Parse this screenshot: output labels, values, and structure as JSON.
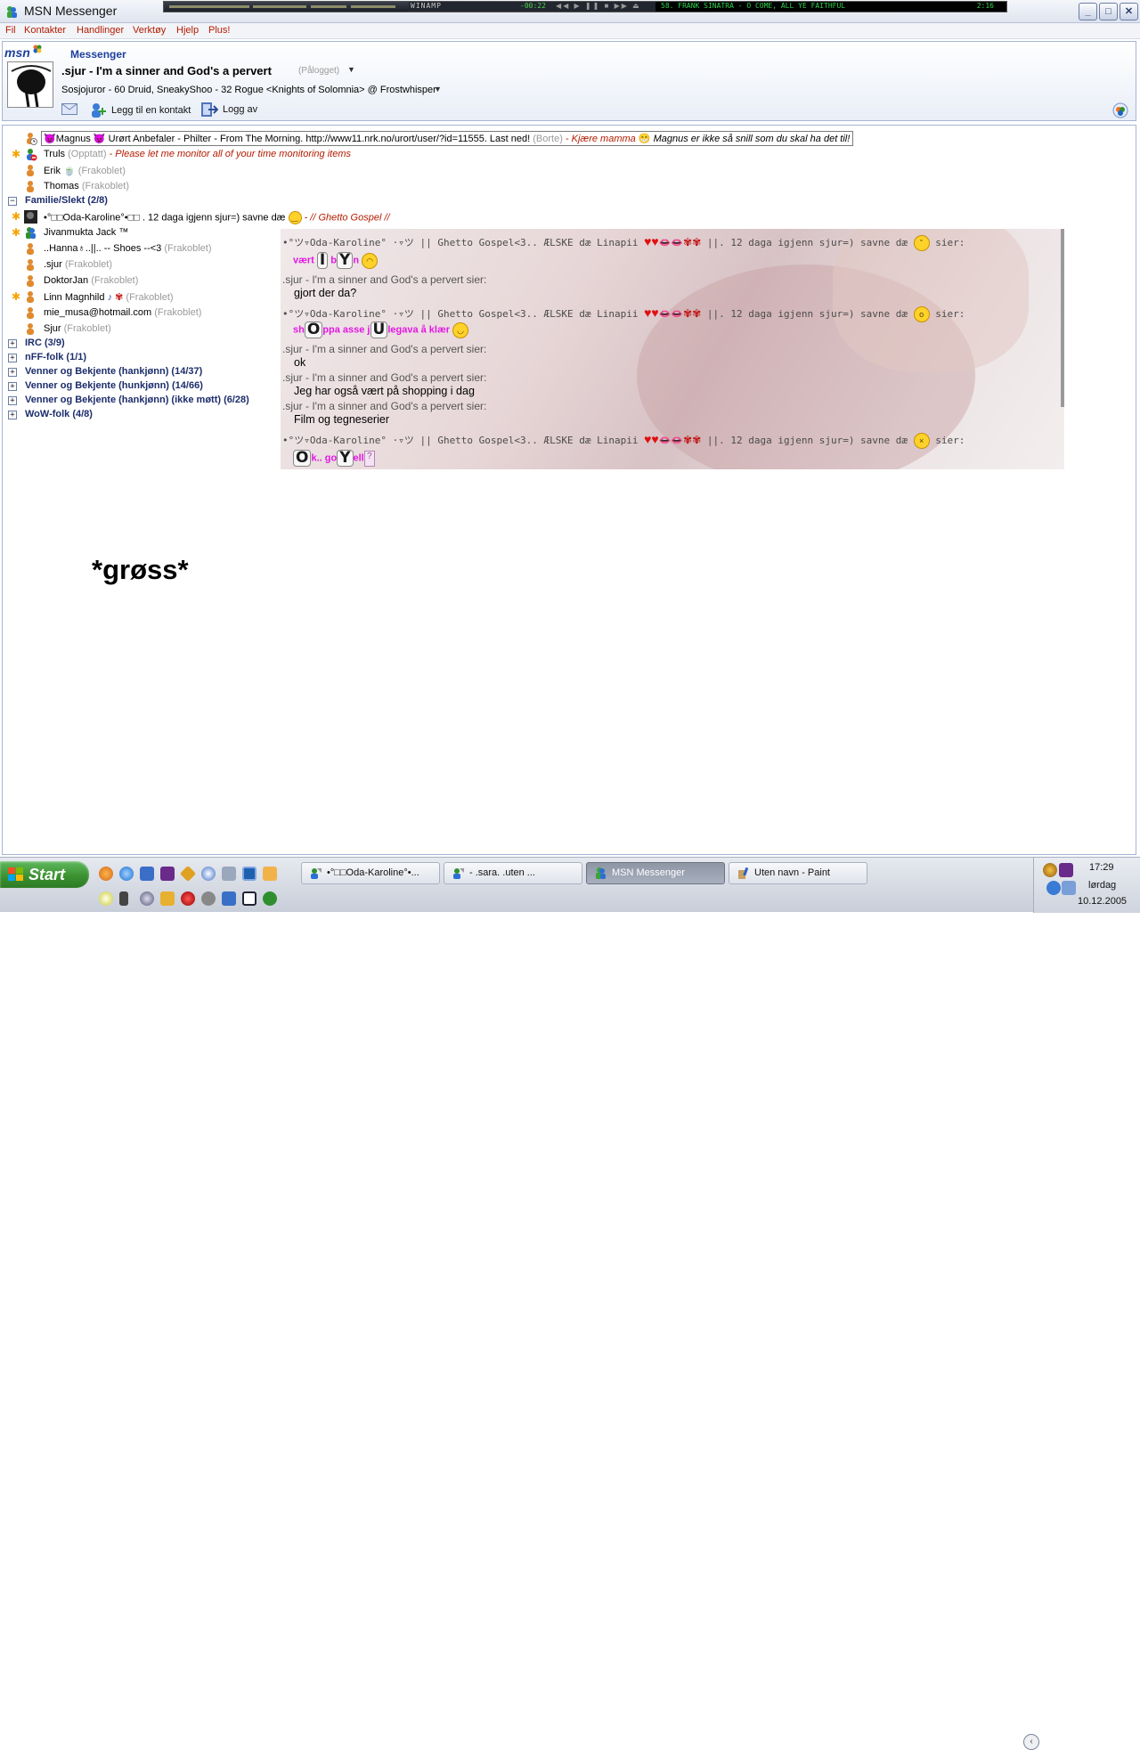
{
  "window": {
    "title": "MSN Messenger",
    "minimize": "_",
    "maximize": "□",
    "close": "✕"
  },
  "winamp": {
    "label": "WINAMP",
    "elapsed": "-00:22",
    "controls": "◀◀ ▶ ❚❚ ■ ▶▶ ⏏",
    "song": "58. FRANK SINATRA - O COME, ALL YE FAITHFUL",
    "song_time": "2:16"
  },
  "menu": [
    "Fil",
    "Kontakter",
    "Handlinger",
    "Verktøy",
    "Hjelp",
    "Plus!"
  ],
  "header": {
    "logo": "msn",
    "app_label": "Messenger",
    "display_name": ".sjur  -  I'm a sinner and God's a pervert",
    "status": "(Pålogget)",
    "personal_message": "Sosjojuror - 60 Druid, SneakyShoo - 32 Rogue <Knights of Solomnia> @ Frostwhisper",
    "add_contact": "Legg til en kontakt",
    "log_off": "Logg av"
  },
  "contacts_top": [
    {
      "name": "Magnus",
      "message": " Urørt Anbefaler - Philter - From The Morning. http://www11.nrk.no/urort/user/?id=11555. Last ned! ",
      "status": "(Borte)",
      "tail": " - Kjære mamma ",
      "tail2": " Magnus er ikke så snill som du skal ha det til!"
    },
    {
      "name": "Truls",
      "status": "(Opptatt)",
      "message": " - Please let me monitor all of your time monitoring items"
    },
    {
      "name": "Erik",
      "status": "(Frakoblet)"
    },
    {
      "name": "Thomas",
      "status": "(Frakoblet)"
    }
  ],
  "group_family": {
    "name": "Familie/Slekt (2/8)",
    "expander": "−",
    "contacts": [
      {
        "name": "•°□□Oda-Karoline°•□□ . 12 daga igjenn  sjur=) savne dæ ",
        "message": " - // Ghetto Gospel //"
      },
      {
        "name": "Jivanmukta Jack ™",
        "status": ""
      },
      {
        "name": "..Hanna♁..||..     -- Shoes --<3 ",
        "status": "(Frakoblet)"
      },
      {
        "name": ".sjur ",
        "status": "(Frakoblet)"
      },
      {
        "name": "DoktorJan ",
        "status": "(Frakoblet)"
      },
      {
        "name": "Linn Magnhild ",
        "status": "(Frakoblet)"
      },
      {
        "name": "mie_musa@hotmail.com ",
        "status": "(Frakoblet)"
      },
      {
        "name": "Sjur ",
        "status": "(Frakoblet)"
      }
    ]
  },
  "collapsed_groups": [
    "IRC (3/9)",
    "nFF-folk (1/1)",
    "Venner og Bekjente (hankjønn) (14/37)",
    "Venner og Bekjente (hunkjønn) (14/66)",
    "Venner og Bekjente (hankjønn) (ikke møtt) (6/28)",
    "WoW-folk (4/8)"
  ],
  "collapsed_expander": "+",
  "chat": {
    "oda_sender_prefix": "•°ツ▿Oda-Karoline° ·▿ツ || Ghetto Gospel<3.. ÆLSKE dæ Linapii ",
    "oda_sender_suffix": " ||. 12 daga igjenn  sjur=) savne dæ ",
    "says": " sier:",
    "me_sender": ".sjur - I'm a sinner and God's a pervert sier:",
    "m1_a": "vært ",
    "m1_b": " b",
    "m1_c": "n",
    "m2": "gjort der da?",
    "m3_a": "sh",
    "m3_b": "ppa asse j",
    "m3_c": "legava å klær",
    "m4": "ok",
    "m5": "Jeg har også vært på shopping i dag",
    "m6": "Film og tegneserier",
    "m7_a": "k.. go",
    "m7_b": "ell"
  },
  "gross": "*grøss*",
  "taskbar": {
    "start": "Start",
    "tasks": [
      {
        "label": "•°□□Oda-Karoline°•...",
        "active": false
      },
      {
        "label": "-      .sara.      .uten ...",
        "active": false
      },
      {
        "label": "MSN Messenger",
        "active": true
      },
      {
        "label": "Uten navn - Paint",
        "active": false
      }
    ],
    "time": "17:29",
    "day": "lørdag",
    "date": "10.12.2005"
  },
  "colors": {
    "status_red": "#b31b00",
    "group_blue": "#1c2d6b",
    "oda_pink": "#e317e3"
  }
}
